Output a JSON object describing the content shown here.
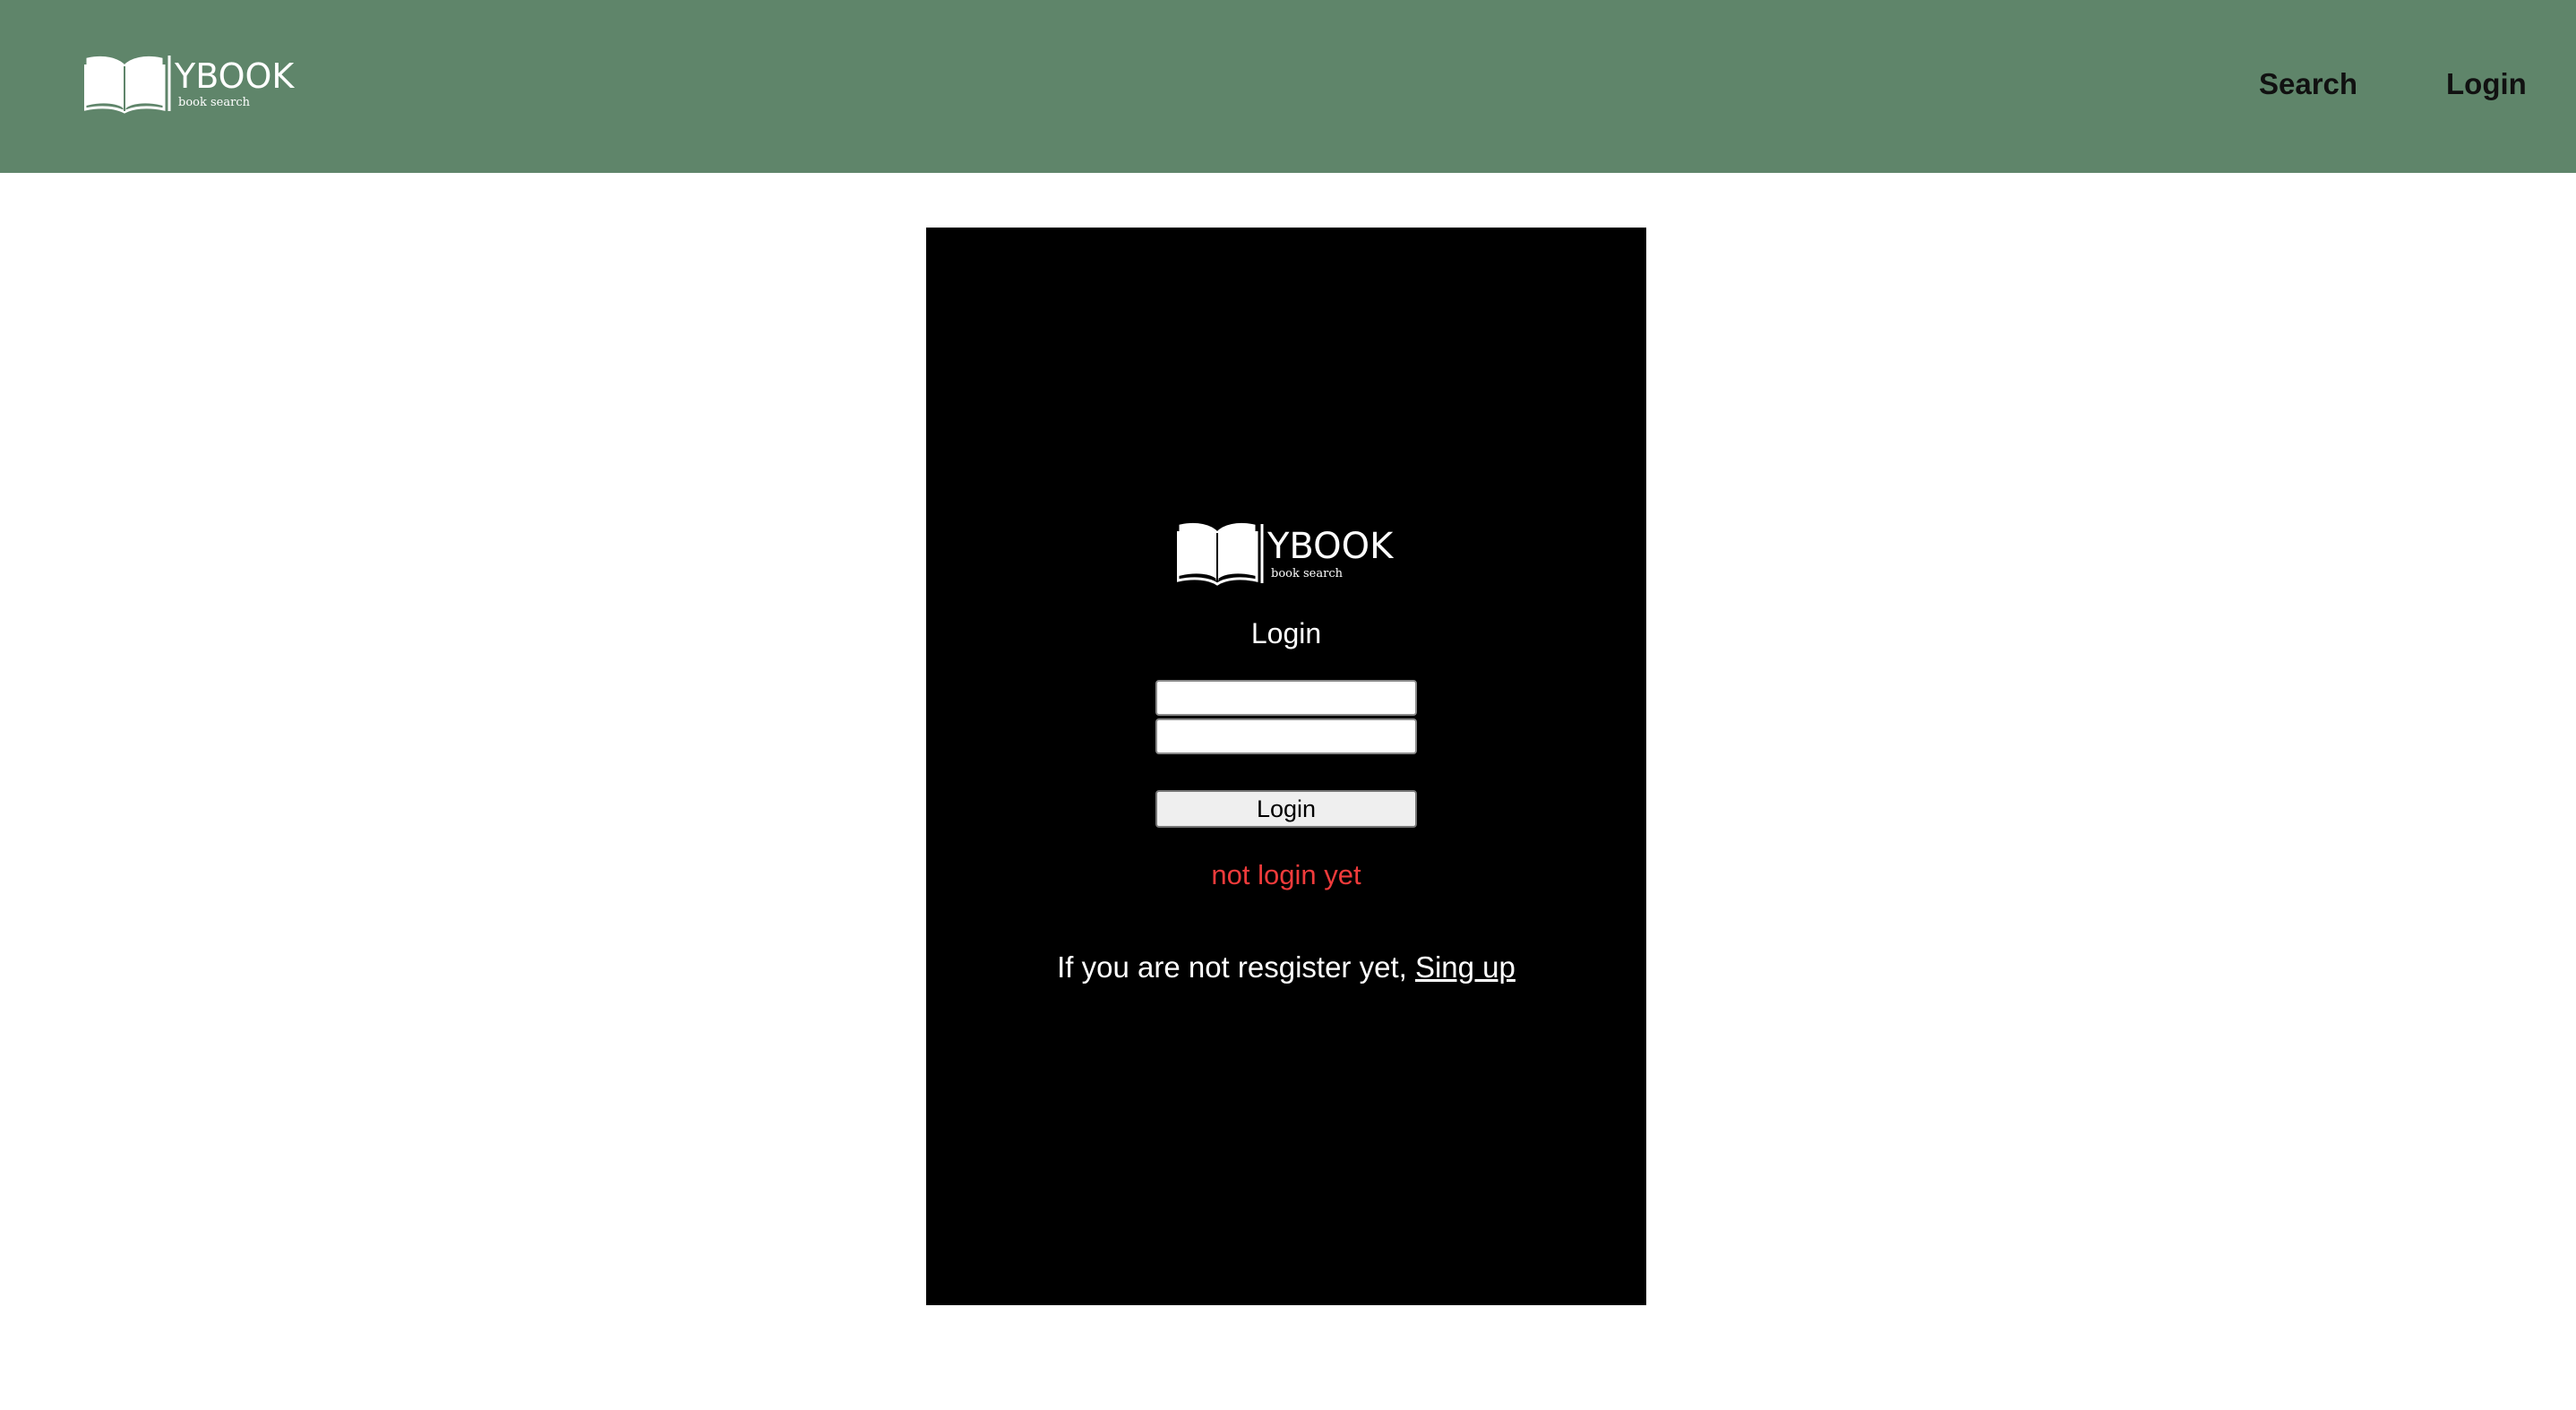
{
  "header": {
    "logo": {
      "brand_text": "YBOOK",
      "tagline": "book search",
      "icon": "open-book-icon"
    },
    "nav": {
      "search_label": "Search",
      "login_label": "Login"
    }
  },
  "login_panel": {
    "logo": {
      "brand_text": "YBOOK",
      "tagline": "book search",
      "icon": "open-book-icon"
    },
    "title": "Login",
    "username_value": "",
    "password_value": "",
    "button_label": "Login",
    "status_text": "not login yet",
    "signup_prompt": "If you are not resgister yet, ",
    "signup_link_label": "Sing up"
  },
  "colors": {
    "header_bg": "#5f856a",
    "panel_bg": "#000000",
    "status_text": "#f03b3b",
    "page_bg": "#ffffff"
  }
}
